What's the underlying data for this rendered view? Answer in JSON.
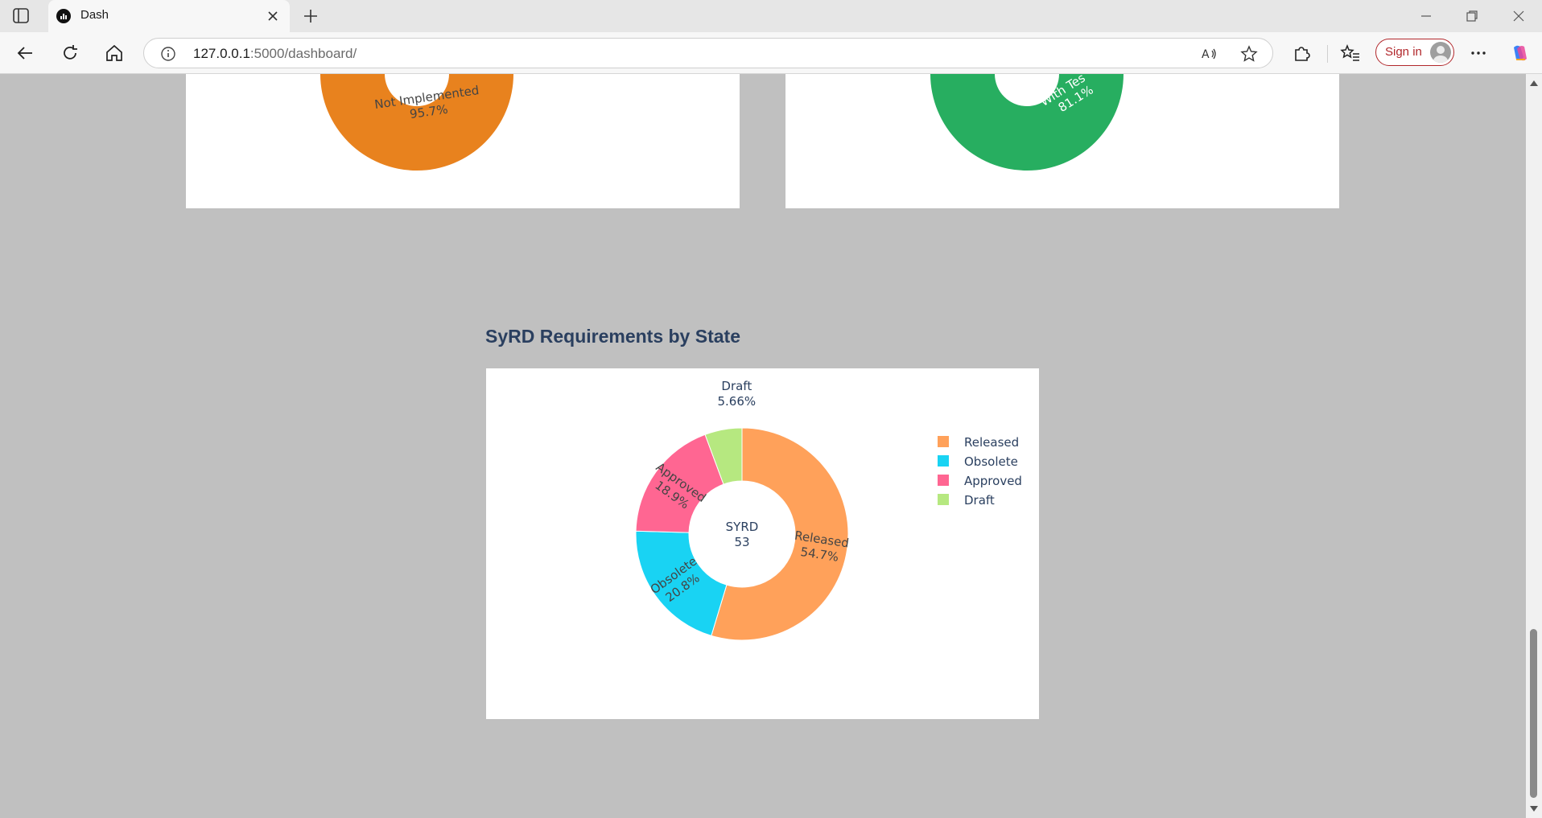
{
  "browser": {
    "tab_title": "Dash",
    "url_host": "127.0.0.1",
    "url_rest": ":5000/dashboard/",
    "signin_label": "Sign in"
  },
  "top_left_chart": {
    "slice_label": "Not Implemented",
    "slice_percent": "95.7%",
    "slice_color": "#e8821e"
  },
  "top_right_chart": {
    "slice_label": "With Tes",
    "slice_percent": "81.1%",
    "slice_color": "#27ae60"
  },
  "section": {
    "title": "SyRD Requirements by State"
  },
  "chart_data": {
    "type": "pie",
    "hole": true,
    "center_label": "SYRD",
    "center_value": "53",
    "legend_position": "top-right",
    "categories": [
      "Released",
      "Obsolete",
      "Approved",
      "Draft"
    ],
    "values": [
      54.7,
      20.8,
      18.9,
      5.66
    ],
    "percent_labels": [
      "54.7%",
      "20.8%",
      "18.9%",
      "5.66%"
    ],
    "colors": [
      "#ffa15a",
      "#19d3f3",
      "#ff6692",
      "#b6e880"
    ]
  }
}
